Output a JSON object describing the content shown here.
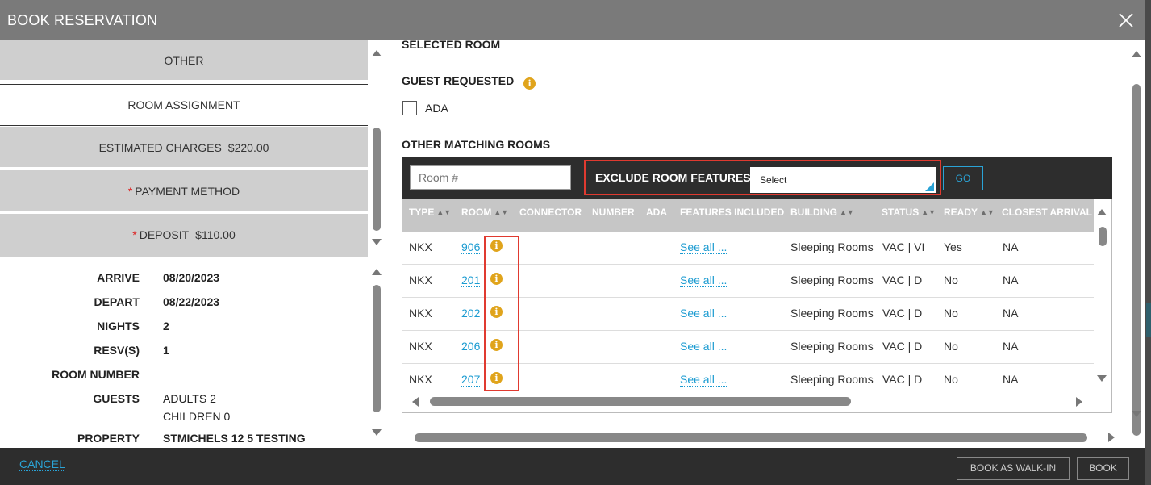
{
  "header": {
    "title": "BOOK RESERVATION"
  },
  "sidebar": {
    "sections": [
      {
        "label": "OTHER"
      },
      {
        "label": "ROOM ASSIGNMENT"
      },
      {
        "label": "ESTIMATED CHARGES",
        "amount": "$220.00"
      },
      {
        "label": "PAYMENT METHOD",
        "required": "*"
      },
      {
        "label": "DEPOSIT",
        "required": "*",
        "amount": "$110.00"
      }
    ],
    "summary": {
      "arrive_label": "ARRIVE",
      "arrive": "08/20/2023",
      "depart_label": "DEPART",
      "depart": "08/22/2023",
      "nights_label": "NIGHTS",
      "nights": "2",
      "resv_label": "RESV(S)",
      "resv": "1",
      "room_number_label": "ROOM NUMBER",
      "room_number": "",
      "guests_label": "GUESTS",
      "adults": "ADULTS 2",
      "children": "CHILDREN 0",
      "property_label": "PROPERTY",
      "property": "STMICHELS 12 5 TESTING"
    }
  },
  "main": {
    "selected_room_title": "SELECTED ROOM",
    "guest_requested_title": "GUEST REQUESTED",
    "ada_label": "ADA",
    "ada_checked": false,
    "other_matching_title": "OTHER MATCHING ROOMS",
    "toolbar": {
      "room_placeholder": "Room #",
      "exclude_label": "EXCLUDE ROOM FEATURES",
      "exclude_select": "Select",
      "go_label": "GO"
    },
    "table": {
      "columns": [
        "TYPE",
        "ROOM",
        "CONNECTOR",
        "NUMBER",
        "ADA",
        "FEATURES INCLUDED",
        "BUILDING",
        "STATUS",
        "READY",
        "CLOSEST ARRIVAL O"
      ],
      "rows": [
        {
          "type": "NKX",
          "room": "906",
          "features": "See all ...",
          "building": "Sleeping Rooms",
          "status": "VAC | VI",
          "ready": "Yes",
          "closest": "NA"
        },
        {
          "type": "NKX",
          "room": "201",
          "features": "See all ...",
          "building": "Sleeping Rooms",
          "status": "VAC | D",
          "ready": "No",
          "closest": "NA"
        },
        {
          "type": "NKX",
          "room": "202",
          "features": "See all ...",
          "building": "Sleeping Rooms",
          "status": "VAC | D",
          "ready": "No",
          "closest": "NA"
        },
        {
          "type": "NKX",
          "room": "206",
          "features": "See all ...",
          "building": "Sleeping Rooms",
          "status": "VAC | D",
          "ready": "No",
          "closest": "NA"
        },
        {
          "type": "NKX",
          "room": "207",
          "features": "See all ...",
          "building": "Sleeping Rooms",
          "status": "VAC | D",
          "ready": "No",
          "closest": "NA"
        }
      ]
    }
  },
  "footer": {
    "cancel_label": "CANCEL",
    "walk_in_label": "BOOK AS WALK-IN",
    "book_label": "BOOK"
  },
  "icons": {
    "info": "i",
    "close": "close-icon"
  },
  "colors": {
    "accent": "#2aa3d6",
    "info": "#e0a41c",
    "highlight": "#e03a30",
    "header": "#7a7a7a"
  }
}
